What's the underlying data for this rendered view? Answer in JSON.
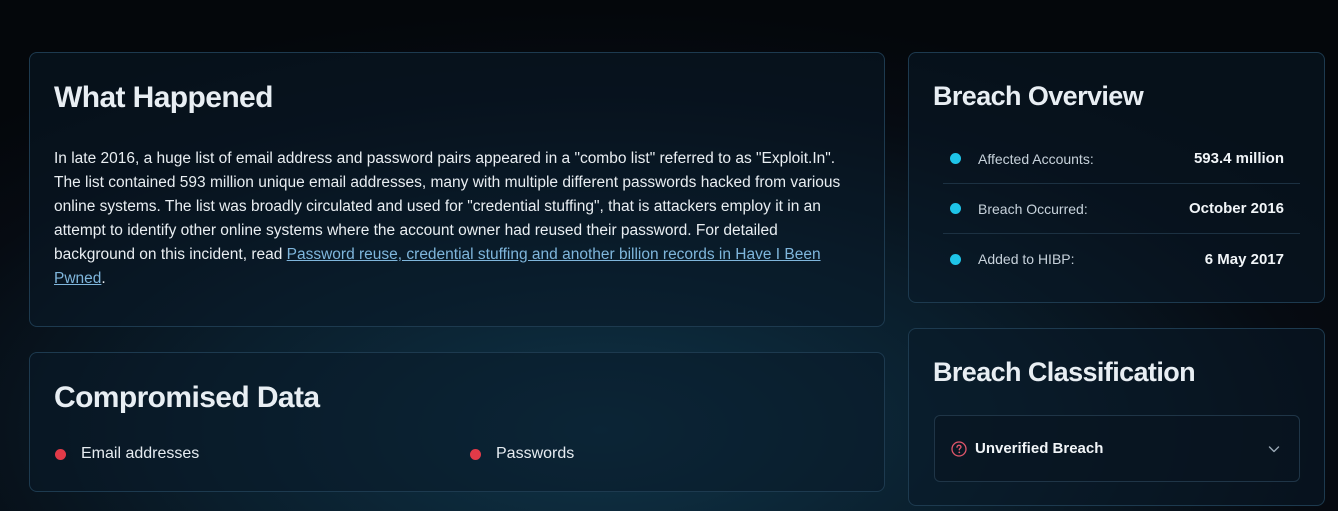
{
  "what_happened": {
    "title": "What Happened",
    "body": "In late 2016, a huge list of email address and password pairs appeared in a \"combo list\" referred to as \"Exploit.In\". The list contained 593 million unique email addresses, many with multiple different passwords hacked from various online systems. The list was broadly circulated and used for \"credential stuffing\", that is attackers employ it in an attempt to identify other online systems where the account owner had reused their password. For detailed background on this incident, read ",
    "link_text": "Password reuse, credential stuffing and another billion records in Have I Been Pwned",
    "body_end": "."
  },
  "compromised_data": {
    "title": "Compromised Data",
    "items": [
      "Email addresses",
      "Passwords"
    ]
  },
  "breach_overview": {
    "title": "Breach Overview",
    "rows": [
      {
        "label": "Affected Accounts:",
        "value": "593.4 million"
      },
      {
        "label": "Breach Occurred:",
        "value": "October 2016"
      },
      {
        "label": "Added to HIBP:",
        "value": "6 May 2017"
      }
    ]
  },
  "breach_classification": {
    "title": "Breach Classification",
    "selected": "Unverified Breach",
    "icon": "question-circle-icon"
  },
  "colors": {
    "accent_cyan": "#1ec4e8",
    "accent_red": "#e23a48",
    "link": "#7fb6dc"
  }
}
